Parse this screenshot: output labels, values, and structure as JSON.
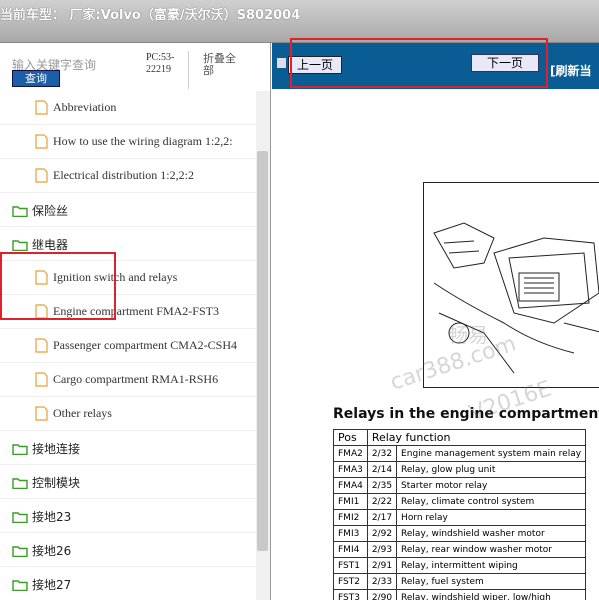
{
  "header": {
    "title": "当前车型： 厂家:Volvo（富豪/沃尔沃）S802004"
  },
  "sidebar": {
    "search_placeholder": "输入关键字查询",
    "search_button": "查询",
    "pc_label": "PC:53-22219",
    "collapse_all": "折叠全部",
    "items": [
      {
        "type": "doc",
        "label": "Abbreviation"
      },
      {
        "type": "doc",
        "label": "How to use the wiring diagram 1:2,2:"
      },
      {
        "type": "doc",
        "label": "Electrical distribution 1:2,2:2"
      },
      {
        "type": "folder",
        "label": "保险丝"
      },
      {
        "type": "folder",
        "label": "继电器"
      },
      {
        "type": "doc",
        "label": "Ignition switch and relays"
      },
      {
        "type": "doc",
        "label": "Engine compartment FMA2-FST3"
      },
      {
        "type": "doc",
        "label": "Passenger compartment CMA2-CSH4"
      },
      {
        "type": "doc",
        "label": "Cargo compartment RMA1-RSH6"
      },
      {
        "type": "doc",
        "label": "Other relays"
      },
      {
        "type": "folder",
        "label": "接地连接"
      },
      {
        "type": "folder",
        "label": "控制模块"
      },
      {
        "type": "folder",
        "label": "接地23"
      },
      {
        "type": "folder",
        "label": "接地26"
      },
      {
        "type": "folder",
        "label": "接地27"
      }
    ]
  },
  "nav": {
    "prev_label": "上一页",
    "next_label": "下一页",
    "refresh_label": "[刷新当"
  },
  "document": {
    "heading": "Relays in the engine compartment",
    "columns": [
      "Pos",
      "Relay function"
    ],
    "rows": [
      [
        "FMA2",
        "2/32",
        "Engine management system main relay"
      ],
      [
        "FMA3",
        "2/14",
        "Relay, glow plug unit"
      ],
      [
        "FMA4",
        "2/35",
        "Starter motor relay"
      ],
      [
        "FMI1",
        "2/22",
        "Relay, climate control system"
      ],
      [
        "FMI2",
        "2/17",
        "Horn relay"
      ],
      [
        "FMI3",
        "2/92",
        "Relay, windshield washer motor"
      ],
      [
        "FMI4",
        "2/93",
        "Relay, rear window washer motor"
      ],
      [
        "FST1",
        "2/91",
        "Relay, intermittent wiping"
      ],
      [
        "FST2",
        "2/33",
        "Relay, fuel system"
      ],
      [
        "FST3",
        "2/90",
        "Relay, windshield wiper, low/high"
      ]
    ],
    "watermark": [
      "畅易",
      "car388.com",
      "V2016E"
    ]
  },
  "colors": {
    "nav_blue": "#0a5d94",
    "highlight_red": "#e0202a",
    "folder_green": "#3a9a2a",
    "doc_orange": "#e8a030"
  }
}
